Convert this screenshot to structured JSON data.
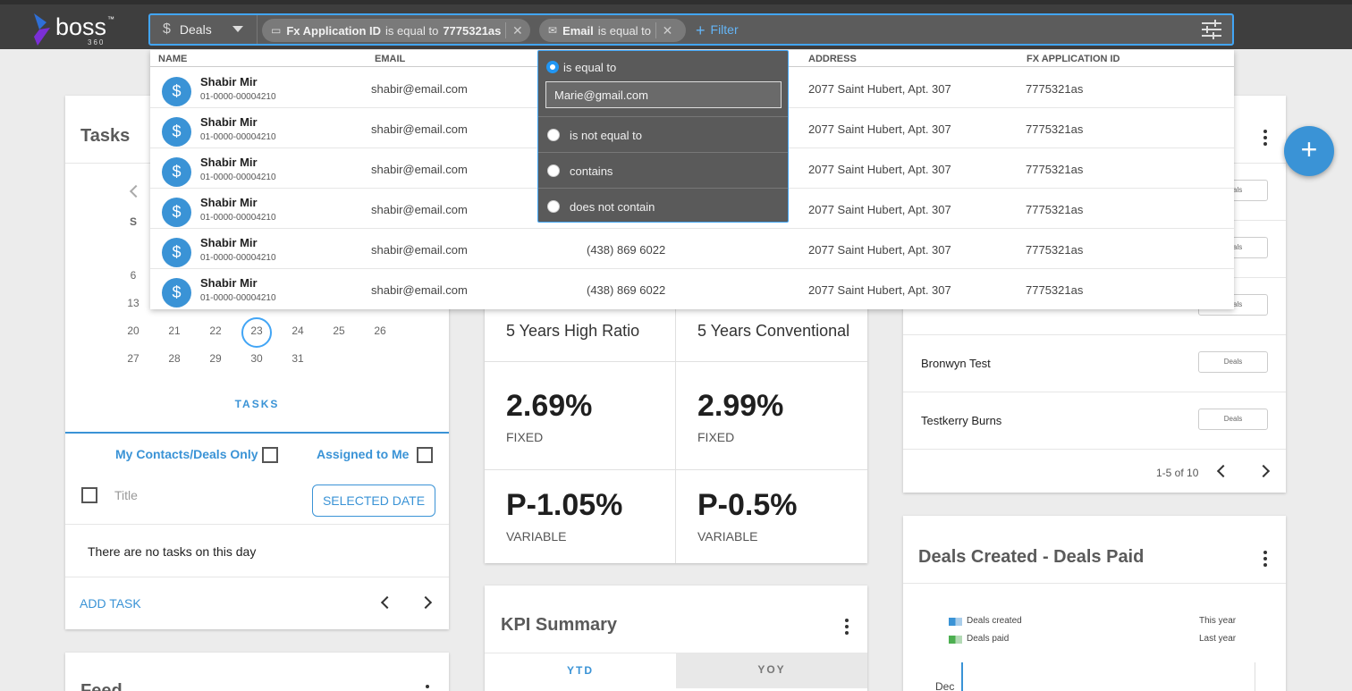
{
  "brand": {
    "name": "boss",
    "suffix": "360",
    "tm": "™"
  },
  "search": {
    "entity": "Deals",
    "chips": [
      {
        "field": "Fx Application ID",
        "op": "is equal to",
        "value": "7775321as"
      },
      {
        "field": "Email",
        "op": "is equal to",
        "value": ""
      }
    ],
    "add_filter": "Filter"
  },
  "results": {
    "headers": [
      "NAME",
      "EMAIL",
      "ADDRESS",
      "FX APPLICATION ID"
    ],
    "rows": [
      {
        "name": "Shabir Mir",
        "id": "01-0000-00004210",
        "email": "shabir@email.com",
        "phone": "",
        "address": "2077 Saint Hubert, Apt. 307",
        "fx": "7775321as"
      },
      {
        "name": "Shabir Mir",
        "id": "01-0000-00004210",
        "email": "shabir@email.com",
        "phone": "",
        "address": "2077 Saint Hubert, Apt. 307",
        "fx": "7775321as"
      },
      {
        "name": "Shabir Mir",
        "id": "01-0000-00004210",
        "email": "shabir@email.com",
        "phone": "",
        "address": "2077 Saint Hubert, Apt. 307",
        "fx": "7775321as"
      },
      {
        "name": "Shabir Mir",
        "id": "01-0000-00004210",
        "email": "shabir@email.com",
        "phone": "",
        "address": "2077 Saint Hubert, Apt. 307",
        "fx": "7775321as"
      },
      {
        "name": "Shabir Mir",
        "id": "01-0000-00004210",
        "email": "shabir@email.com",
        "phone": "(438) 869 6022",
        "address": "2077 Saint Hubert, Apt. 307",
        "fx": "7775321as"
      },
      {
        "name": "Shabir Mir",
        "id": "01-0000-00004210",
        "email": "shabir@email.com",
        "phone": "(438) 869 6022",
        "address": "2077 Saint Hubert, Apt. 307",
        "fx": "7775321as"
      }
    ]
  },
  "operator_menu": {
    "options": [
      "is equal to",
      "is not equal to",
      "contains",
      "does not contain"
    ],
    "selected": "is equal to",
    "value": "Marie@gmail.com"
  },
  "tasks": {
    "title": "Tasks",
    "weekday_initial": "S",
    "days_visible": [
      "6",
      "13",
      "20",
      "21",
      "22",
      "23",
      "24",
      "25",
      "26",
      "27",
      "28",
      "29",
      "30",
      "31"
    ],
    "today": "23",
    "tab_label": "TASKS",
    "my_contacts": "My Contacts/Deals Only",
    "assigned": "Assigned to Me",
    "title_col": "Title",
    "selected_date": "SELECTED DATE",
    "empty": "There are no tasks on this day",
    "add_task": "ADD TASK"
  },
  "feed": {
    "title": "Feed"
  },
  "rates": {
    "col1": "5 Years High Ratio",
    "col2": "5 Years Conventional",
    "fixed1": "2.69%",
    "fixed2": "2.99%",
    "fixed_label": "FIXED",
    "var1": "P-1.05%",
    "var2": "P-0.5%",
    "var_label": "VARIABLE"
  },
  "kpi": {
    "title": "KPI Summary",
    "tab1": "YTD",
    "tab2": "YOY"
  },
  "deals_list": {
    "rows": [
      {
        "name": "",
        "badge": "Deals"
      },
      {
        "name": "",
        "badge": "Deals"
      },
      {
        "name": "",
        "badge": "Deals"
      },
      {
        "name": "Bronwyn Test",
        "badge": "Deals"
      },
      {
        "name": "Testkerry Burns",
        "badge": "Deals"
      }
    ],
    "pagination": "1-5 of 10"
  },
  "deals_chart": {
    "title": "Deals Created - Deals Paid",
    "legend": [
      {
        "label": "Deals created",
        "period": "This year",
        "color": "#3a93d6"
      },
      {
        "label": "Deals paid",
        "period": "Last year",
        "color": "#4caf50"
      }
    ],
    "first_category": "Dec"
  }
}
